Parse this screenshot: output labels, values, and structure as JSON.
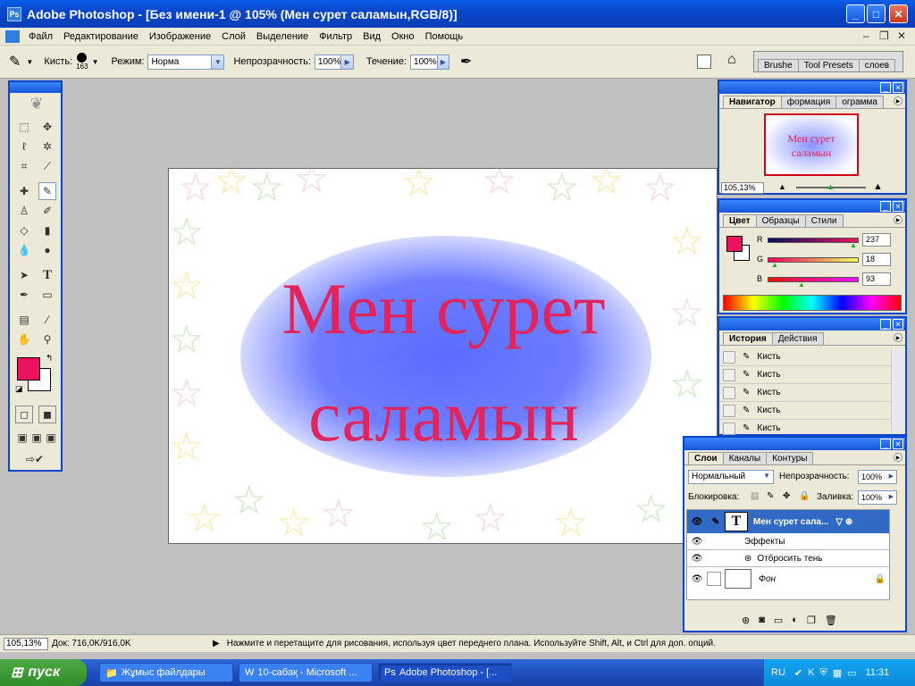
{
  "window": {
    "title": "Adobe Photoshop - [Без имени-1 @ 105% (Мен сурет  саламын,RGB/8)]",
    "logo": "Ps"
  },
  "menu": [
    "Файл",
    "Редактирование",
    "Изображение",
    "Слой",
    "Выделение",
    "Фильтр",
    "Вид",
    "Окно",
    "Помощь"
  ],
  "options": {
    "brush_label": "Кисть:",
    "brush_size": "163",
    "mode_label": "Режим:",
    "mode_value": "Норма",
    "opacity_label": "Непрозрачность:",
    "opacity_value": "100%",
    "flow_label": "Течение:",
    "flow_value": "100%",
    "well_tabs": [
      "Brushe",
      "Tool Presets",
      "слоев"
    ]
  },
  "canvas": {
    "line1": "Мен сурет",
    "line2": "саламын",
    "text_color": "#e0245e"
  },
  "navigator": {
    "tabs": [
      "Навигатор",
      "формация",
      "ограмма"
    ],
    "zoom": "105,13%",
    "thumb_line1": "Мен сурет",
    "thumb_line2": "саламын"
  },
  "color": {
    "tabs": [
      "Цвет",
      "Образцы",
      "Стили"
    ],
    "r_label": "R",
    "g_label": "G",
    "b_label": "B",
    "r": "237",
    "g": "18",
    "b": "93",
    "fg": "#ed125d"
  },
  "history": {
    "tabs": [
      "История",
      "Действия"
    ],
    "items": [
      "Кисть",
      "Кисть",
      "Кисть",
      "Кисть",
      "Кисть"
    ]
  },
  "layers": {
    "tabs": [
      "Слои",
      "Каналы",
      "Контуры"
    ],
    "blend": "Нормальный",
    "opacity_label": "Непрозрачность:",
    "opacity": "100%",
    "lock_label": "Блокировка:",
    "fill_label": "Заливка:",
    "fill": "100%",
    "text_layer": "Мен сурет  сала...",
    "effects": "Эффекты",
    "drop_shadow": "Отбросить тень",
    "bg_layer": "Фон"
  },
  "status": {
    "zoom": "105,13%",
    "doc": "Док: 716,0K/916,0K",
    "hint": "Нажмите и перетащите для рисования, используя цвет переднего плана. Используйте Shift, Alt, и Ctrl для доп. опций."
  },
  "taskbar": {
    "start": "пуск",
    "tasks": [
      "Жұмыс файлдары",
      "10-сабақ - Microsoft ...",
      "Adobe Photoshop - [..."
    ],
    "lang": "RU",
    "time": "11:31"
  }
}
